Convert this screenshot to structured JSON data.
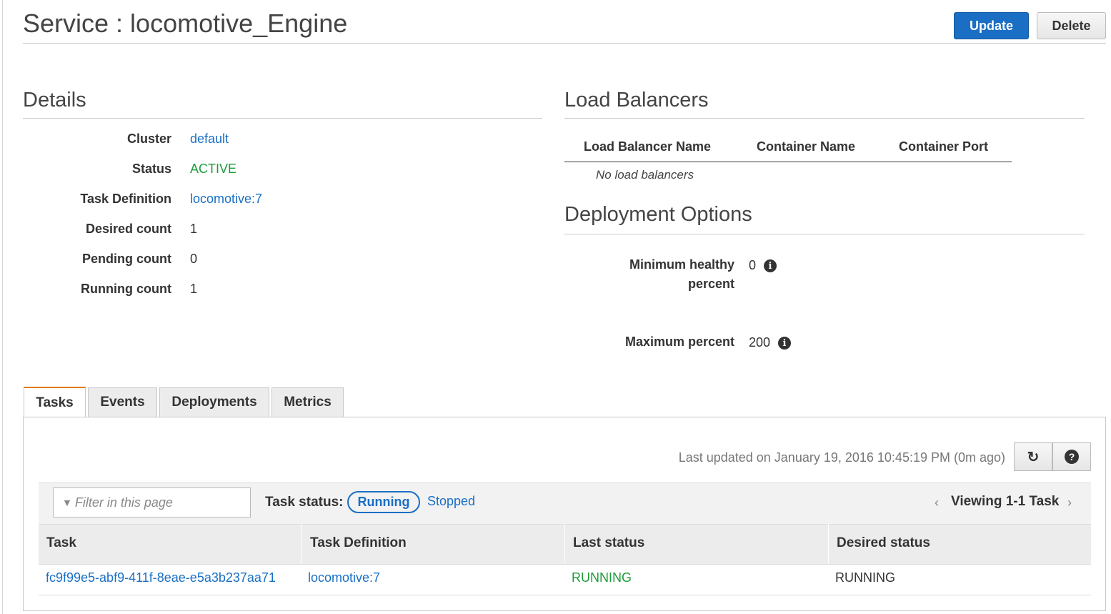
{
  "header": {
    "title": "Service : locomotive_Engine",
    "update_label": "Update",
    "delete_label": "Delete"
  },
  "details": {
    "heading": "Details",
    "rows": [
      {
        "label": "Cluster",
        "value": "default"
      },
      {
        "label": "Status",
        "value": "ACTIVE"
      },
      {
        "label": "Task Definition",
        "value": "locomotive:7"
      },
      {
        "label": "Desired count",
        "value": "1"
      },
      {
        "label": "Pending count",
        "value": "0"
      },
      {
        "label": "Running count",
        "value": "1"
      }
    ]
  },
  "load_balancers": {
    "heading": "Load Balancers",
    "columns": [
      "Load Balancer Name",
      "Container Name",
      "Container Port"
    ],
    "empty_text": "No load balancers"
  },
  "deployment_options": {
    "heading": "Deployment Options",
    "min_healthy_label_1": "Minimum healthy",
    "min_healthy_label_2": "percent",
    "min_healthy_value": "0",
    "max_percent_label": "Maximum percent",
    "max_percent_value": "200",
    "info_icon": "i"
  },
  "tabs": [
    {
      "label": "Tasks",
      "active": true
    },
    {
      "label": "Events",
      "active": false
    },
    {
      "label": "Deployments",
      "active": false
    },
    {
      "label": "Metrics",
      "active": false
    }
  ],
  "tasks_panel": {
    "last_updated": "Last updated on January 19, 2016 10:45:19 PM (0m ago)",
    "refresh_icon": "↻",
    "help_icon": "?",
    "filter_icon": "▼",
    "filter_placeholder": "Filter in this page",
    "task_status_label": "Task status:",
    "status_running": "Running",
    "status_stopped": "Stopped",
    "pager_prev": "‹",
    "pager_text": "Viewing 1-1 Task",
    "pager_next": "›",
    "columns": [
      "Task",
      "Task Definition",
      "Last status",
      "Desired status"
    ],
    "rows": [
      {
        "task": "fc9f99e5-abf9-411f-8eae-e5a3b237aa71",
        "task_definition": "locomotive:7",
        "last_status": "RUNNING",
        "desired_status": "RUNNING"
      }
    ]
  },
  "colors": {
    "primary": "#1a6fc4",
    "active_green": "#1e9b3a",
    "tab_accent": "#e07b00"
  }
}
